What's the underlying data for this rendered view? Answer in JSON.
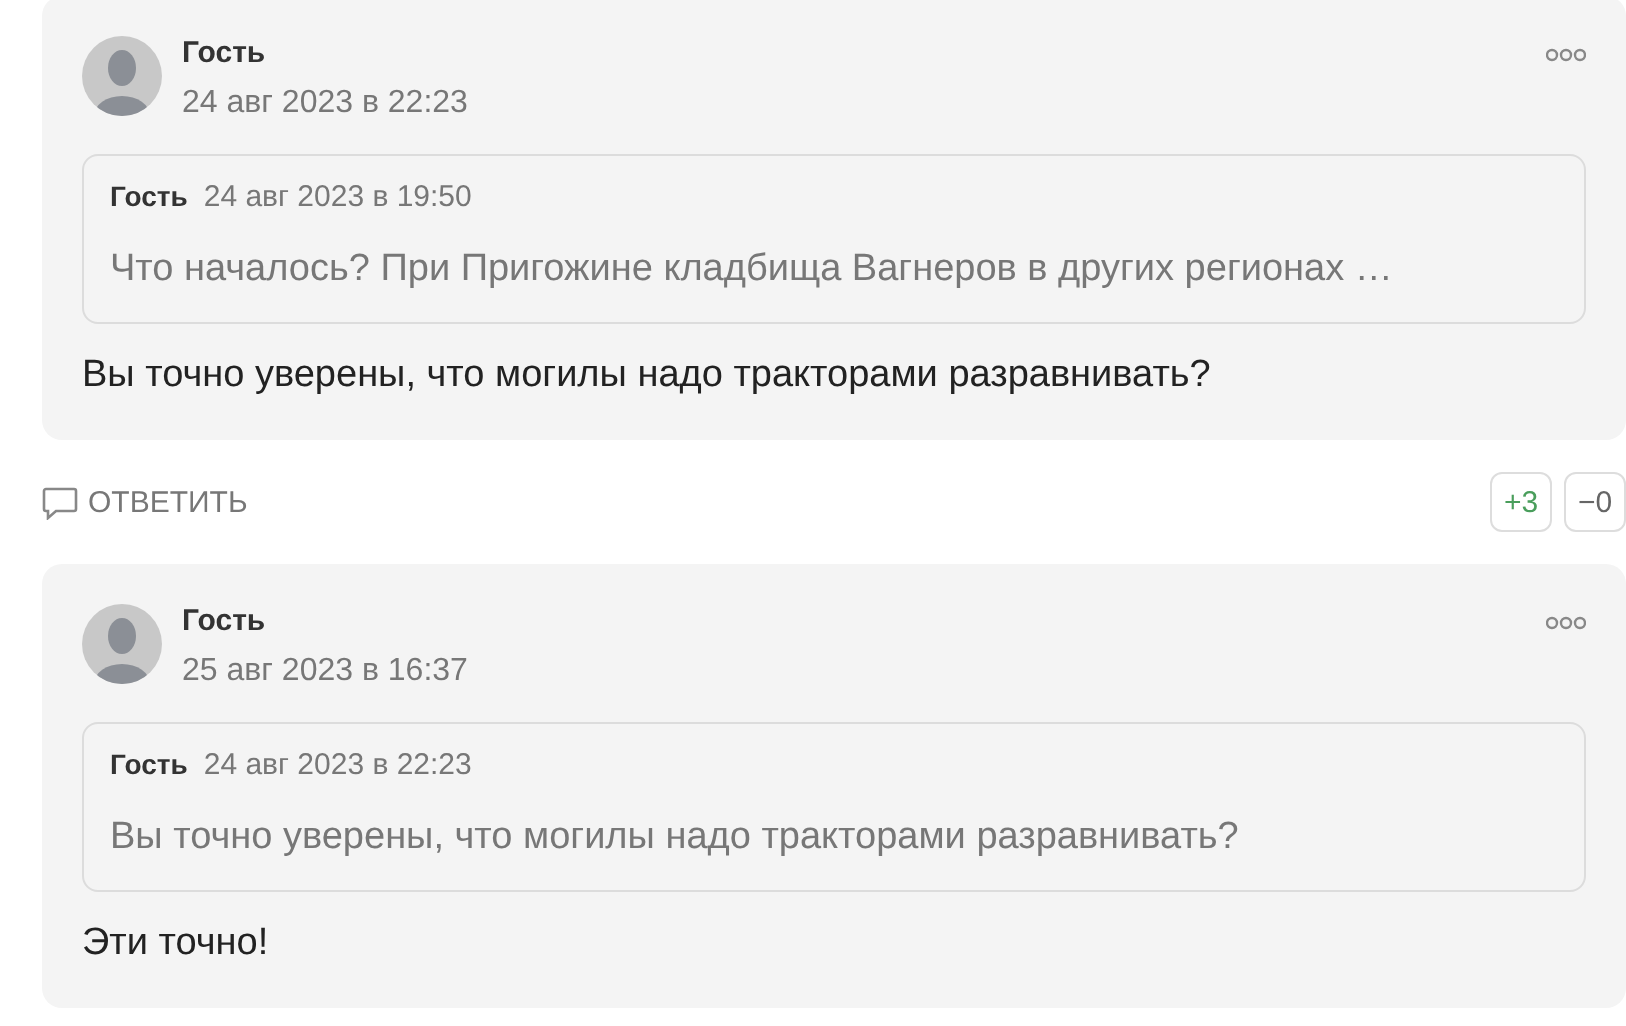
{
  "comments": [
    {
      "author": "Гость",
      "date": "24 авг 2023 в 22:23",
      "quote": {
        "author": "Гость",
        "date": "24 авг 2023 в 19:50",
        "text": "Что началось? При Пригожине кладбища Вагнеров в других регионах …"
      },
      "text": "Вы точно уверены, что могилы надо тракторами разравнивать?",
      "reply_label": "ОТВЕТИТЬ",
      "votes": {
        "up": "+3",
        "down": "−0"
      }
    },
    {
      "author": "Гость",
      "date": "25 авг 2023 в 16:37",
      "quote": {
        "author": "Гость",
        "date": "24 авг 2023 в 22:23",
        "text": "Вы точно уверены, что могилы надо тракторами разравнивать?"
      },
      "text": "Эти точно!"
    }
  ]
}
